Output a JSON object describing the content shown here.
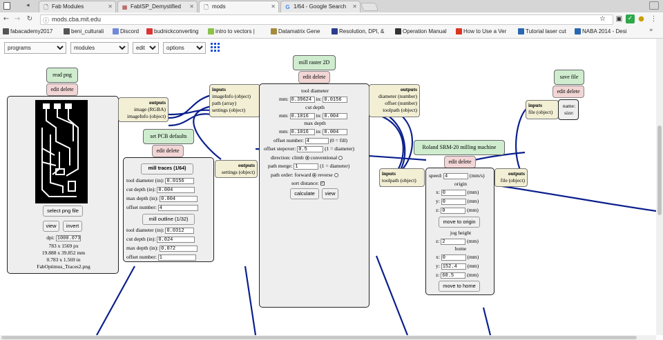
{
  "tabs": [
    {
      "label": "Fab Modules",
      "favicon": "doc-icon"
    },
    {
      "label": "FabISP_Demystified",
      "favicon": "grid-icon"
    },
    {
      "label": "mods",
      "favicon": "doc-icon"
    },
    {
      "label": "1/64 - Google Search",
      "favicon": "google-icon"
    }
  ],
  "address": {
    "url": "mods.cba.mit.edu"
  },
  "bookmarks": [
    "fabacademy2017",
    "beni_culturali",
    "Discord",
    "budnickconverting",
    "intro to vectors |",
    "Datamatrix Gene",
    "Resolution, DPI, &",
    "Operation Manual",
    "How to Use a Ver",
    "Tutorial laser cut",
    "NABA 2014 - Desi"
  ],
  "menus": {
    "programs": "programs",
    "modules": "modules",
    "edit": "edit",
    "options": "options"
  },
  "read_png": {
    "title": "read png",
    "edit_delete": "edit delete",
    "select_button": "select png file",
    "view_button": "view",
    "invert_button": "invert",
    "dpi_label": "dpi:",
    "dpi_value": "1000.073",
    "size_px": "783 x 1569 px",
    "size_mm": "19.888 x 39.852 mm",
    "size_in": "0.783 x 1.569 in",
    "filename": "FabOptimus_Traces2.png",
    "outputs_title": "outputs",
    "output1": "image (RGBA)",
    "output2": "imageInfo (object)"
  },
  "pcb_defaults": {
    "title": "set PCB defaults",
    "edit_delete": "edit delete",
    "traces_button": "mill traces (1/64)",
    "outline_button": "mill outline (1/32)",
    "rows1": [
      {
        "label": "tool diameter (in):",
        "value": "0.0156"
      },
      {
        "label": "cut depth (in):",
        "value": "0.004"
      },
      {
        "label": "max depth (in):",
        "value": "0.004"
      },
      {
        "label": "offset number:",
        "value": "4"
      }
    ],
    "rows2": [
      {
        "label": "tool diameter (in):",
        "value": "0.0312"
      },
      {
        "label": "cut depth (in):",
        "value": "0.024"
      },
      {
        "label": "max depth (in):",
        "value": "0.072"
      },
      {
        "label": "offset number:",
        "value": "1"
      }
    ],
    "outputs_title": "outputs",
    "output1": "settings (object)"
  },
  "mill_raster": {
    "title": "mill raster 2D",
    "edit_delete": "edit delete",
    "inputs_title": "inputs",
    "input1": "imageInfo (object)",
    "input2": "path (array)",
    "input3": "settings (object)",
    "tool_diameter": "tool diameter",
    "mm": "mm:",
    "in": "in:",
    "td_mm": "0.39624",
    "td_in": "0.0156",
    "cut_depth": "cut depth",
    "cd_mm": "0.1016",
    "cd_in": "0.004",
    "max_depth": "max depth",
    "md_mm": "0.1016",
    "md_in": "0.004",
    "offset_number_label": "offset number:",
    "offset_number": "4",
    "offset_fill": "(0 = fill)",
    "stepover_label": "offset stepover:",
    "stepover": "0.5",
    "stepover_note": "(1 = diameter)",
    "direction_label": "direction:",
    "climb": "climb",
    "conventional": "conventional",
    "merge_label": "path merge:",
    "merge": "1",
    "merge_note": "(1 = diameter)",
    "order_label": "path order:",
    "forward": "forward",
    "reverse": "reverse",
    "sort_label": "sort distance:",
    "calculate": "calculate",
    "view": "view",
    "outputs_title": "outputs",
    "output1": "diameter (number)",
    "output2": "offset (number)",
    "output3": "toolpath (object)"
  },
  "roland": {
    "title": "Roland SRM-20 milling machine",
    "edit_delete": "edit delete",
    "inputs_title": "inputs",
    "input1": "toolpath (object)",
    "speed_label": "speed:",
    "speed": "4",
    "speed_unit": "(mm/s)",
    "origin": "origin",
    "x_label": "x:",
    "y_label": "y:",
    "z_label": "z:",
    "ox": "0",
    "oy": "0",
    "oz": "0",
    "mm_unit": "(mm)",
    "move_origin": "move to origin",
    "jog_height": "jog height",
    "jz": "2",
    "home": "home",
    "hx": "0",
    "hy": "152.4",
    "hz": "60.5",
    "move_home": "move to home",
    "outputs_title": "outputs",
    "output1": "file (object)"
  },
  "save_file": {
    "title": "save file",
    "edit_delete": "edit delete",
    "inputs_title": "inputs",
    "input1": "file (object)",
    "name": "name:",
    "size": "size:"
  },
  "colors": {
    "wire": "#0a1f8c",
    "node_title": "#cfeccf",
    "edit_bar": "#f2d5d5",
    "io_box": "#f2efd4"
  }
}
